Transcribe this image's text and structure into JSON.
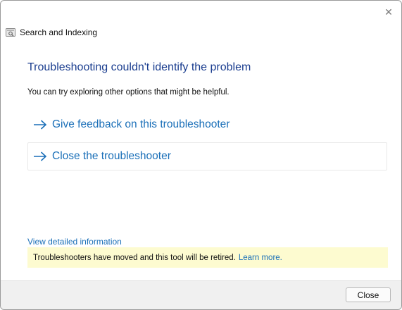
{
  "window": {
    "app_title": "Search and Indexing",
    "close_glyph": "✕"
  },
  "main": {
    "heading": "Troubleshooting couldn't identify the problem",
    "subtext": "You can try exploring other options that might be helpful.",
    "options": [
      {
        "label": "Give feedback on this troubleshooter",
        "icon": "arrow-right-icon"
      },
      {
        "label": "Close the troubleshooter",
        "icon": "arrow-right-icon"
      }
    ],
    "detail_link": "View detailed information",
    "notice": {
      "text": "Troubleshooters have moved and this tool will be retired.",
      "link": "Learn more."
    }
  },
  "footer": {
    "close_label": "Close"
  },
  "colors": {
    "heading": "#1a3d8f",
    "link": "#1a6fb8",
    "notice_bg": "#fdfbd0",
    "footer_bg": "#f0f0f0"
  }
}
